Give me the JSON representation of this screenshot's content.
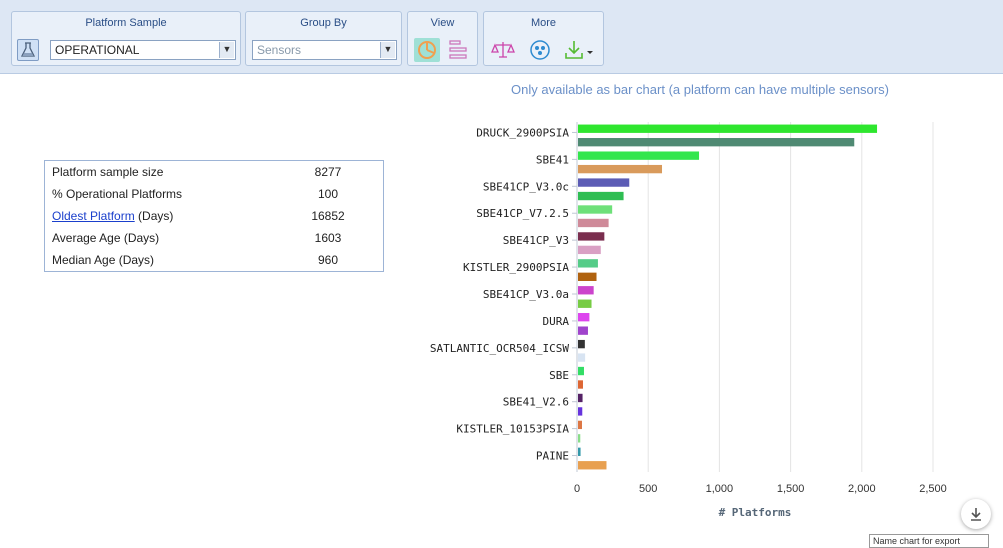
{
  "toolbar": {
    "platform_sample": {
      "title": "Platform Sample",
      "value": "OPERATIONAL"
    },
    "group_by": {
      "title": "Group By",
      "value": "Sensors"
    },
    "view": {
      "title": "View",
      "icons": [
        "pie-chart-icon",
        "bar-chart-icon"
      ]
    },
    "more": {
      "title": "More",
      "icons": [
        "balance-scale-icon",
        "bubbles-icon",
        "download-icon"
      ]
    }
  },
  "stats_table": {
    "rows": [
      {
        "label": "Platform sample size",
        "value": "8277"
      },
      {
        "label": "% Operational Platforms",
        "value": "100"
      },
      {
        "label_link": "Oldest Platform",
        "label_suffix": " (Days)",
        "value": "16852"
      },
      {
        "label": "Average Age (Days)",
        "value": "1603"
      },
      {
        "label": "Median Age (Days)",
        "value": "960"
      }
    ]
  },
  "chart_data": {
    "type": "bar",
    "orientation": "horizontal",
    "subtitle": "Only available as bar chart (a platform can have multiple sensors)",
    "xlabel": "# Platforms",
    "xlim": [
      0,
      2500
    ],
    "xticks": [
      "0",
      "500",
      "1,000",
      "1,500",
      "2,000",
      "2,500"
    ],
    "categories": [
      "DRUCK_2900PSIA",
      "SBE41",
      "SBE41CP_V3.0c",
      "SBE41CP_V7.2.5",
      "SBE41CP_V3",
      "KISTLER_2900PSIA",
      "SBE41CP_V3.0a",
      "DURA",
      "SATLANTIC_OCR504_ICSW",
      "SBE",
      "SBE41_V2.6",
      "KISTLER_10153PSIA",
      "PAINE"
    ],
    "bars": [
      {
        "value": 2100,
        "color": "#2ee62e"
      },
      {
        "value": 1940,
        "color": "#4f8a73"
      },
      {
        "value": 850,
        "color": "#33e64d"
      },
      {
        "value": 590,
        "color": "#d99a5b"
      },
      {
        "value": 360,
        "color": "#5c5cb5"
      },
      {
        "value": 320,
        "color": "#2ebd52"
      },
      {
        "value": 240,
        "color": "#6ee079"
      },
      {
        "value": 215,
        "color": "#cf8a99"
      },
      {
        "value": 185,
        "color": "#7a2e4e"
      },
      {
        "value": 160,
        "color": "#d9a0c4"
      },
      {
        "value": 140,
        "color": "#55cc88"
      },
      {
        "value": 130,
        "color": "#b0620f"
      },
      {
        "value": 110,
        "color": "#cc44cc"
      },
      {
        "value": 95,
        "color": "#77cc44"
      },
      {
        "value": 80,
        "color": "#dd44ee"
      },
      {
        "value": 70,
        "color": "#a044cc"
      },
      {
        "value": 48,
        "color": "#333333"
      },
      {
        "value": 50,
        "color": "#d8e4f2"
      },
      {
        "value": 42,
        "color": "#33dd66"
      },
      {
        "value": 35,
        "color": "#dd6633"
      },
      {
        "value": 32,
        "color": "#552266"
      },
      {
        "value": 30,
        "color": "#6633dd"
      },
      {
        "value": 28,
        "color": "#dd7744"
      },
      {
        "value": 16,
        "color": "#88dd88"
      },
      {
        "value": 18,
        "color": "#3399aa"
      },
      {
        "value": 200,
        "color": "#e8a050"
      }
    ],
    "grid": true
  },
  "export": {
    "placeholder": "Name chart for export"
  }
}
